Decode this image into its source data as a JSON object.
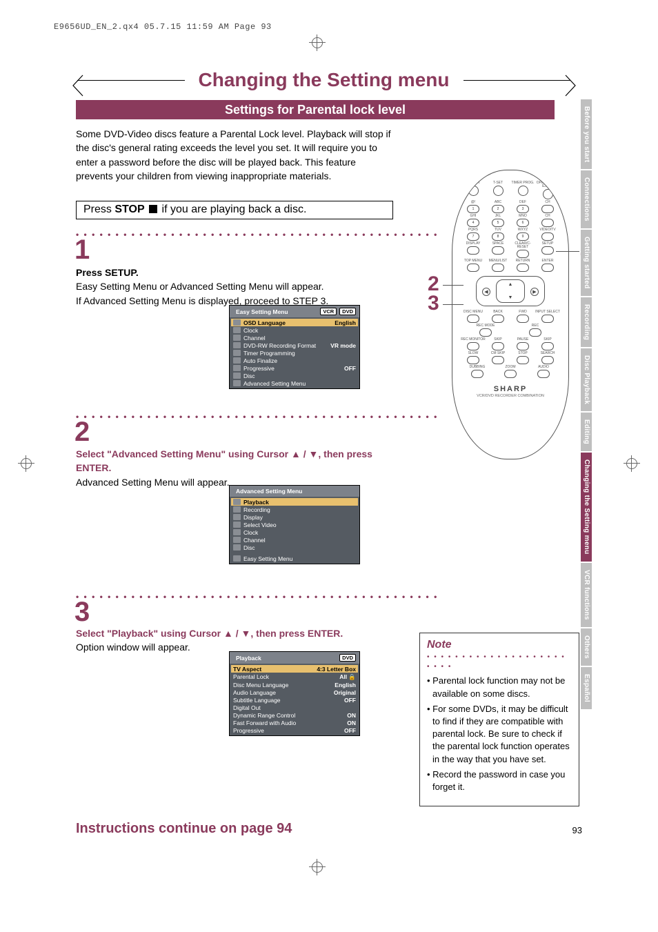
{
  "header_footer_stamp": "E9656UD_EN_2.qx4   05.7.15   11:59 AM   Page 93",
  "title": "Changing the Setting menu",
  "subtitle": "Settings for Parental lock level",
  "intro": "Some DVD-Video discs feature a Parental Lock level. Playback will stop if the disc's general rating exceeds the level you set. It will require you to enter a password before the disc will be played back. This feature prevents your children from viewing inappropriate materials.",
  "stop_prefix": "Press ",
  "stop_word": "STOP",
  "stop_suffix": " if you are playing back a disc.",
  "step1": {
    "num": "1",
    "heading": "Press SETUP.",
    "body": "Easy Setting Menu or Advanced Setting Menu will appear.\nIf Advanced Setting Menu is displayed, proceed to STEP 3."
  },
  "step2": {
    "num": "2",
    "heading": "Select \"Advanced Setting Menu\" using Cursor ▲ / ▼, then press ENTER.",
    "body": "Advanced Setting Menu will appear."
  },
  "step3": {
    "num": "3",
    "heading": "Select \"Playback\" using Cursor ▲ / ▼, then press ENTER.",
    "body": "Option window will appear."
  },
  "easy_menu": {
    "title": "Easy Setting Menu",
    "tags": [
      "VCR",
      "DVD"
    ],
    "rows": [
      {
        "label": "OSD Language",
        "value": "English",
        "selected": true
      },
      {
        "label": "Clock",
        "value": ""
      },
      {
        "label": "Channel",
        "value": ""
      },
      {
        "label": "DVD-RW Recording Format",
        "value": "VR mode"
      },
      {
        "label": "Timer Programming",
        "value": ""
      },
      {
        "label": "Auto Finalize",
        "value": ""
      },
      {
        "label": "Progressive",
        "value": "OFF"
      },
      {
        "label": "Disc",
        "value": ""
      },
      {
        "label": "Advanced Setting Menu",
        "value": ""
      }
    ]
  },
  "adv_menu": {
    "title": "Advanced Setting Menu",
    "rows": [
      {
        "label": "Playback",
        "selected": true
      },
      {
        "label": "Recording"
      },
      {
        "label": "Display"
      },
      {
        "label": "Select Video"
      },
      {
        "label": "Clock"
      },
      {
        "label": "Channel"
      },
      {
        "label": "Disc"
      }
    ],
    "footer": "Easy Setting Menu"
  },
  "playback_menu": {
    "title": "Playback",
    "tag": "DVD",
    "rows": [
      {
        "label": "TV Aspect",
        "value": "4:3 Letter Box",
        "selected": true
      },
      {
        "label": "Parental Lock",
        "value": "All  🔒"
      },
      {
        "label": "Disc Menu Language",
        "value": "English"
      },
      {
        "label": "Audio Language",
        "value": "Original"
      },
      {
        "label": "Subtitle Language",
        "value": "OFF"
      },
      {
        "label": "Digital Out",
        "value": ""
      },
      {
        "label": "Dynamic Range Control",
        "value": "ON"
      },
      {
        "label": "Fast Forward with Audio",
        "value": "ON"
      },
      {
        "label": "Progressive",
        "value": "OFF"
      }
    ]
  },
  "note": {
    "title": "Note",
    "items": [
      "Parental lock function may not be available on some discs.",
      "For some DVDs, it may be difficult to find if they are compatible with parental lock. Be sure to check if the parental lock function operates in the way that you have set.",
      "Record the password in case you forget it."
    ]
  },
  "instr_continue": "Instructions continue on page 94",
  "page_number": "93",
  "callouts": {
    "c1": "1",
    "c2": "2",
    "c3": "3"
  },
  "remote": {
    "row1": [
      "POWER",
      "T-SET",
      "TIMER PROG.",
      "OPEN/CLOSE EJECT"
    ],
    "row2": [
      [
        "@!",
        "1"
      ],
      [
        "ABC",
        "2"
      ],
      [
        "DEF",
        "3"
      ],
      [
        "CH"
      ]
    ],
    "row3": [
      [
        "GHI",
        "4"
      ],
      [
        "JKL",
        "5"
      ],
      [
        "MNO",
        "6"
      ],
      [
        "CH"
      ]
    ],
    "row4": [
      [
        "PQRS",
        "7"
      ],
      [
        "TUV",
        "8"
      ],
      [
        "WXYZ",
        "9"
      ],
      [
        "VIDEO/TV"
      ]
    ],
    "row5": [
      "DISPLAY",
      "SPACE",
      "CLEAR/C-RESET",
      "SETUP"
    ],
    "row6": [
      "TOP MENU",
      "MENU/LIST",
      "RETURN",
      "ENTER"
    ],
    "nav": {
      "left": "◀",
      "right": "▶",
      "up": "▲",
      "down": "▼"
    },
    "row7": [
      "DISC MENU",
      "BACK",
      "FWD",
      "INPUT SELECT"
    ],
    "row8": [
      "REC MODE",
      "REC"
    ],
    "row9": [
      "REC MONITOR",
      "SKIP",
      "PAUSE",
      "SKIP"
    ],
    "row10": [
      "SLOW",
      "CM SKIP",
      "STOP",
      "SEARCH"
    ],
    "row11": [
      "DUBBING",
      "ZOOM",
      "AUDIO"
    ],
    "brand": "SHARP",
    "brandsub": "VCR/DVD RECORDER COMBINATION"
  },
  "side_tabs": [
    {
      "label": "Before you start"
    },
    {
      "label": "Connections"
    },
    {
      "label": "Getting started"
    },
    {
      "label": "Recording"
    },
    {
      "label": "Disc Playback"
    },
    {
      "label": "Editing"
    },
    {
      "label": "Changing the Setting menu",
      "active": true
    },
    {
      "label": "VCR functions"
    },
    {
      "label": "Others"
    },
    {
      "label": "Español"
    }
  ]
}
